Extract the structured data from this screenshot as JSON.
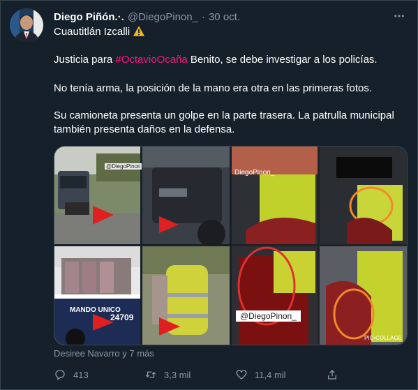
{
  "tweet": {
    "author_name": "Diego Piñón.·.",
    "handle": "@DiegoPinon_",
    "separator": "·",
    "date": "30 oct.",
    "location_line": "Cuautitlán Izcalli",
    "line2_prefix": "Justicia para ",
    "hashtag": "#OctavioOcaña",
    "line2_suffix": " Benito, se debe investigar a los policías.",
    "line3": "No tenía arma, la posición de la mano era otra en las primeras fotos.",
    "line4": "Su camioneta presenta un golpe en la parte trasera. La patrulla municipal también presenta daños en la defensa."
  },
  "media": {
    "left_watermark_top": "@DiegoPinon",
    "left_truck_text": "MANDO UNICO",
    "left_truck_number": "24709",
    "right_watermark_top": "DiegoPinon_",
    "right_watermark_bottom": "@DiegoPinon_",
    "right_collage_credit": "PIC•COLLAGE"
  },
  "tagged_text": "Desiree Navarro y 7 más",
  "actions": {
    "reply_count": "413",
    "retweet_count": "3,3 mil",
    "like_count": "11,4 mil"
  },
  "colors": {
    "background": "#15202b",
    "text": "#ffffff",
    "secondary": "#8899a6",
    "hashtag": "#f91880",
    "border": "#38444d"
  }
}
